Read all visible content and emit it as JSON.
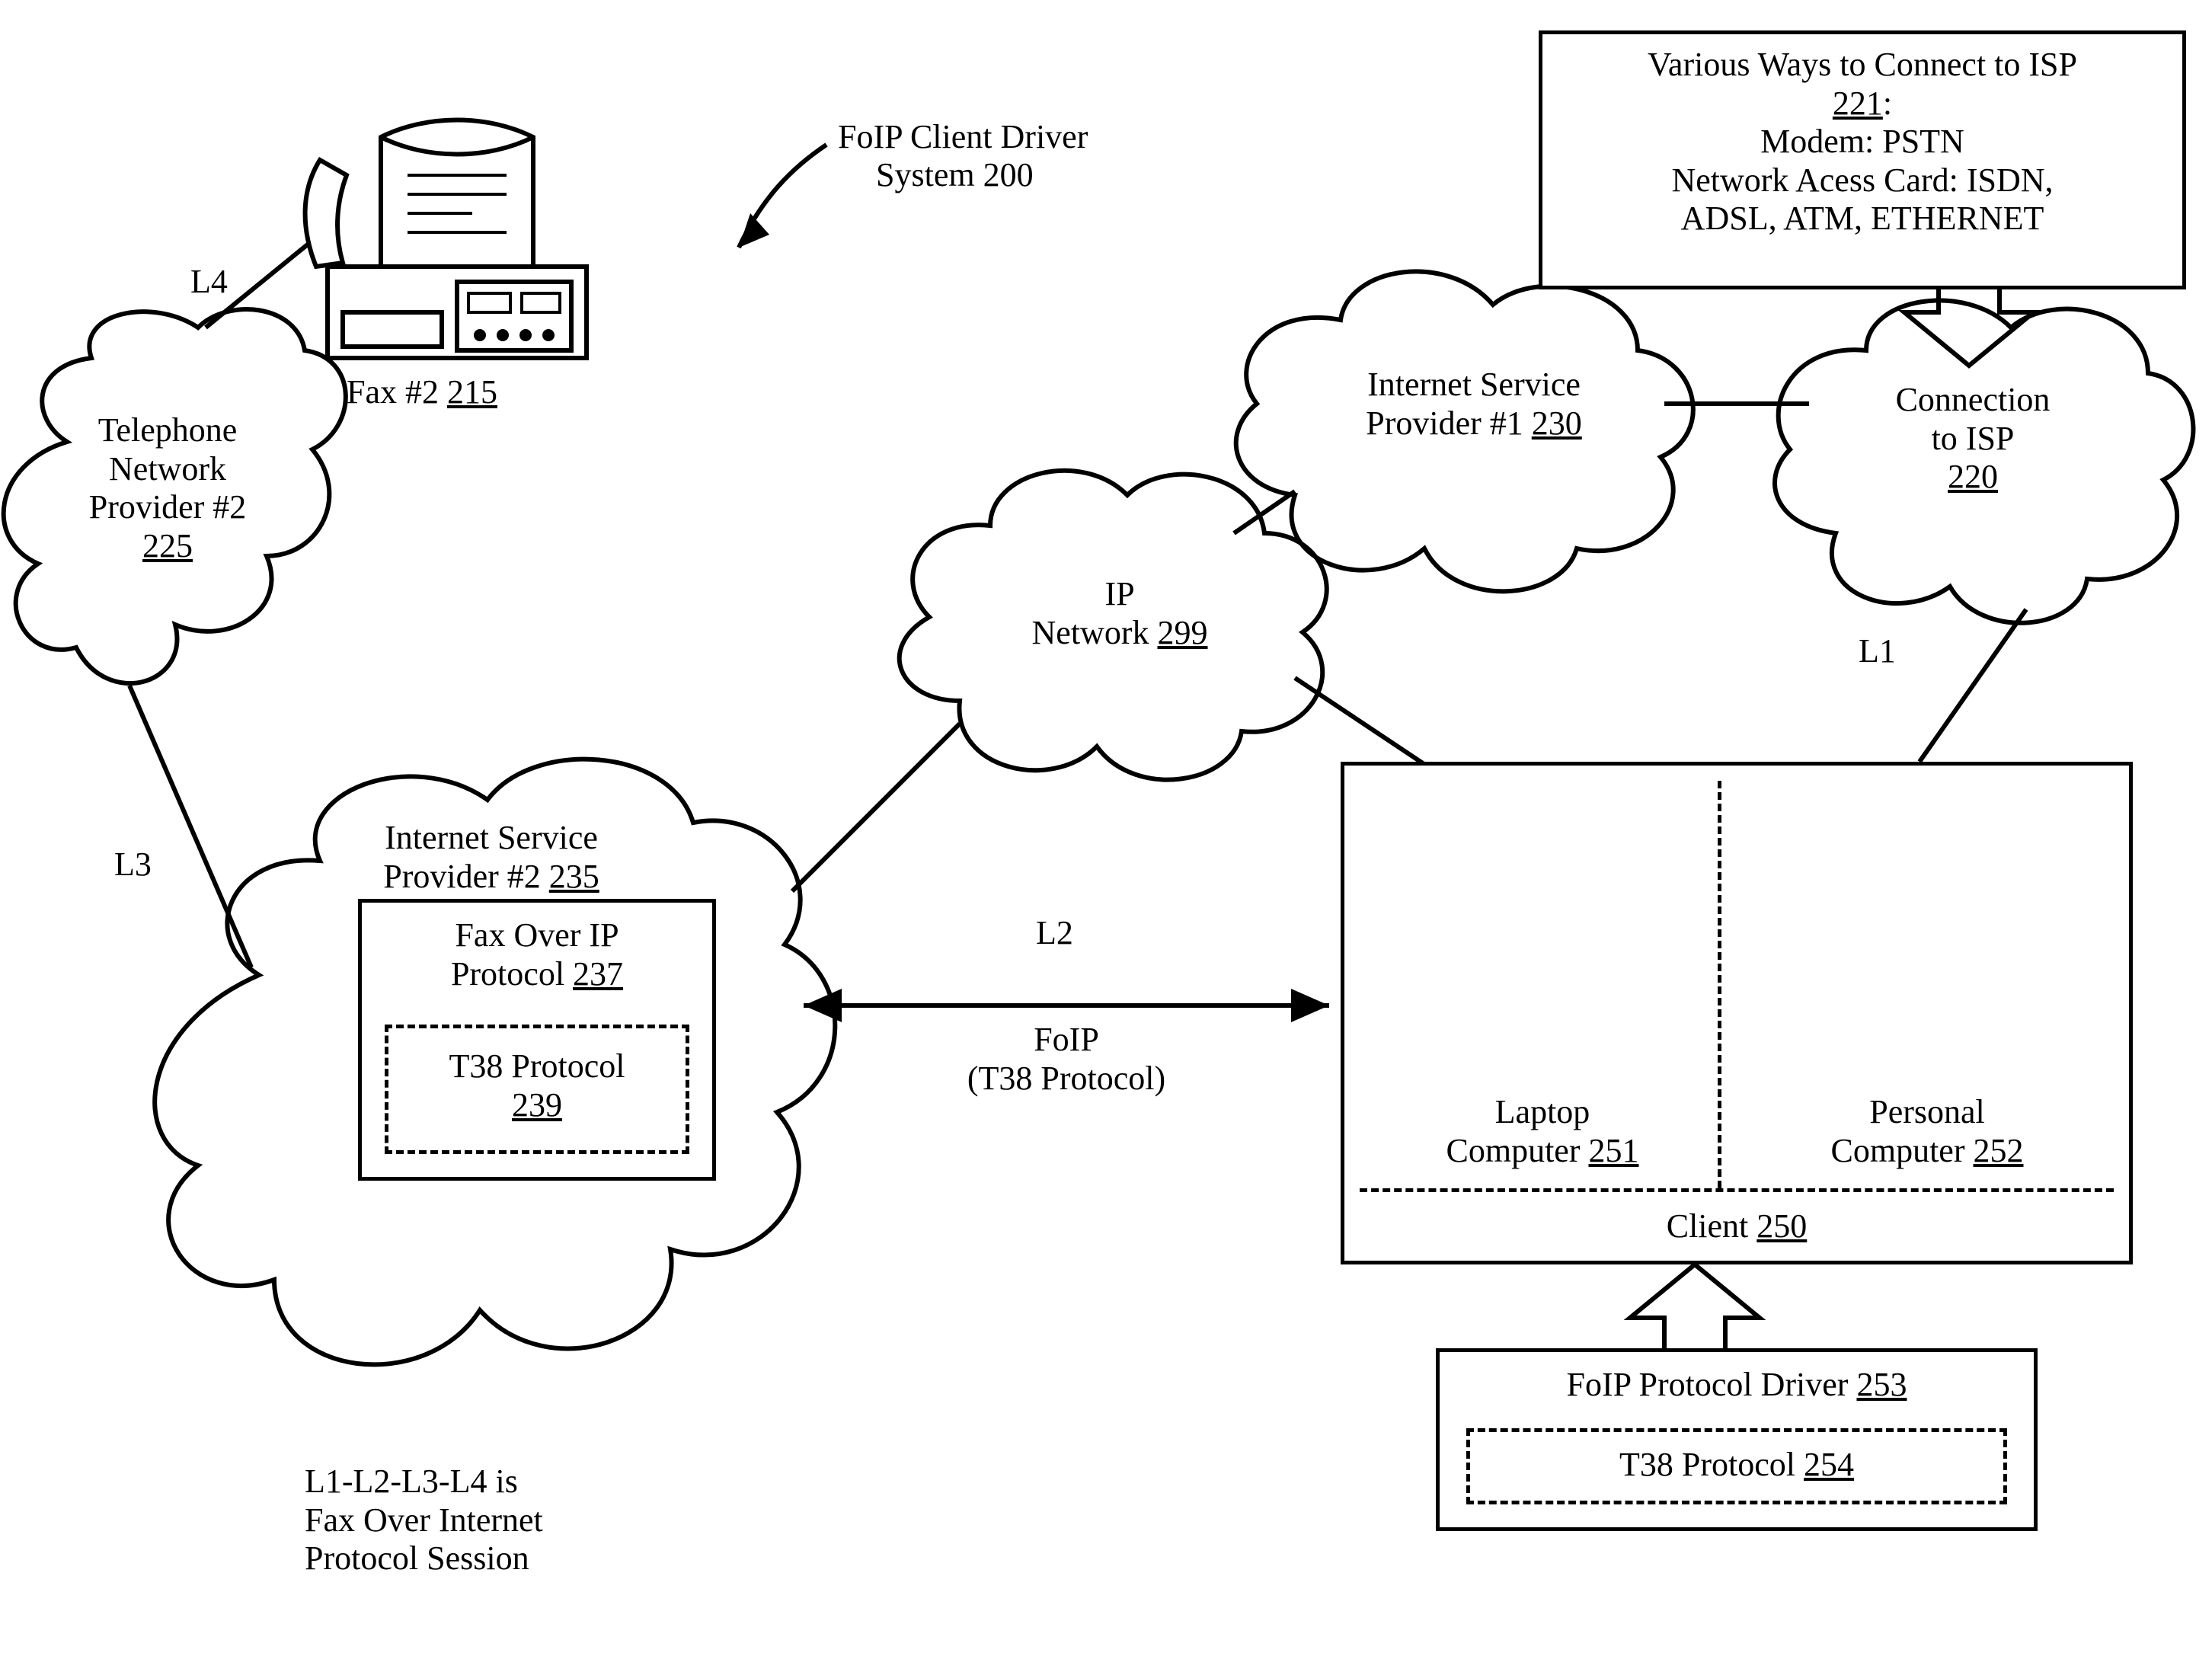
{
  "title": {
    "label": "FoIP Client Driver",
    "sub": "System 200"
  },
  "fax": {
    "label": "Fax #2 ",
    "ref": "215"
  },
  "tel": {
    "l1": "Telephone",
    "l2": "Network",
    "l3": "Provider #2",
    "ref": "225"
  },
  "isp2": {
    "label": "Internet Service",
    "label2": "Provider #2 ",
    "ref": "235"
  },
  "foip_box": {
    "l1": "Fax Over IP",
    "l2": "Protocol ",
    "ref": "237"
  },
  "t38a": {
    "l1": "T38 Protocol",
    "ref": "239"
  },
  "ipnet": {
    "l1": "IP",
    "l2": "Network ",
    "ref": "299"
  },
  "isp1": {
    "l1": "Internet Service",
    "l2": "Provider #1 ",
    "ref": "230"
  },
  "conn": {
    "l1": "Connection",
    "l2": "to ISP",
    "ref": "220"
  },
  "ways": {
    "l1": "Various Ways to Connect to ISP",
    "ref": "221",
    "colon": ":",
    "l2": "Modem: PSTN",
    "l3": "Network Acess Card: ISDN,",
    "l4": "ADSL, ATM, ETHERNET"
  },
  "laptop": {
    "l1": "Laptop",
    "l2": "Computer ",
    "ref": "251"
  },
  "pc": {
    "l1": "Personal",
    "l2": "Computer ",
    "ref": "252"
  },
  "client": {
    "label": "Client ",
    "ref": "250"
  },
  "driver": {
    "label": "FoIP Protocol Driver ",
    "ref": "253"
  },
  "t38b": {
    "label": "T38 Protocol ",
    "ref": "254"
  },
  "links": {
    "L1": "L1",
    "L2": "L2",
    "L3": "L3",
    "L4": "L4"
  },
  "foipline": {
    "l1": "FoIP",
    "l2": "(T38 Protocol)"
  },
  "session": {
    "l1": "L1-L2-L3-L4 is",
    "l2": "Fax Over Internet",
    "l3": "Protocol Session"
  }
}
